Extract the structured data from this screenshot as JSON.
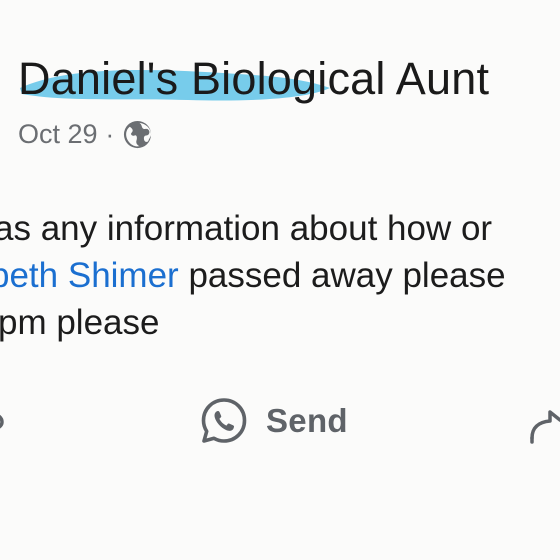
{
  "post": {
    "author_name": "Daniel's Biological Aunt",
    "date": "Oct 29",
    "separator": "·",
    "audience_icon": "globe-icon",
    "highlight_color": "#5fc3e8",
    "body": {
      "line1": "as any information about how or",
      "line2_mention": "beth Shimer",
      "line2_rest": " passed away please",
      "line3": "pm please"
    },
    "mention_color": "#1b6fd0"
  },
  "actions": {
    "send_label": "Send",
    "send_icon": "whatsapp-icon",
    "left_icon": "comment-icon",
    "right_icon": "share-icon"
  }
}
